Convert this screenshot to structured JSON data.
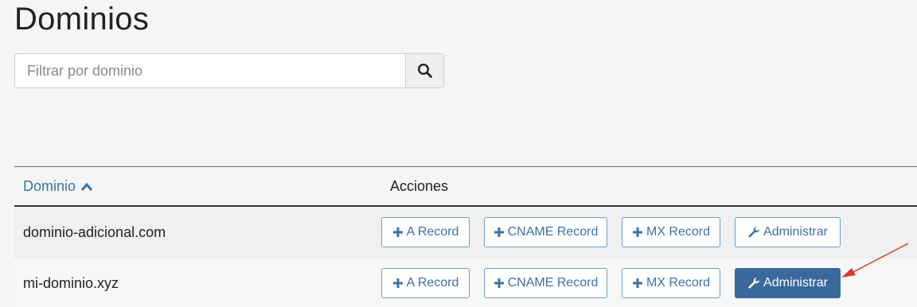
{
  "page": {
    "title": "Dominios"
  },
  "search": {
    "placeholder": "Filtrar por dominio",
    "icon": "search-icon"
  },
  "table": {
    "columns": {
      "domain": "Dominio",
      "domain_sort": "ascending",
      "actions": "Acciones"
    },
    "rows": [
      {
        "domain": "dominio-adicional.com",
        "a_record": "A Record",
        "cname_record": "CNAME Record",
        "mx_record": "MX Record",
        "admin": "Administrar"
      },
      {
        "domain": "mi-dominio.xyz",
        "a_record": "A Record",
        "cname_record": "CNAME Record",
        "mx_record": "MX Record",
        "admin": "Administrar"
      }
    ]
  },
  "colors": {
    "link_blue": "#3d72a8",
    "primary_button": "#39699c",
    "annotation_arrow": "#d63a2f"
  }
}
